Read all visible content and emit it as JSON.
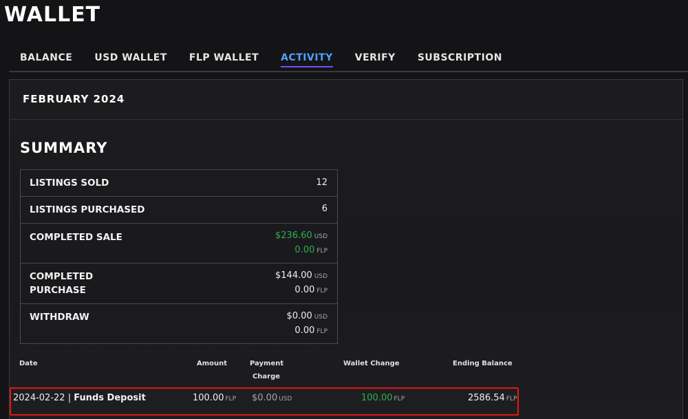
{
  "header": {
    "title": "WALLET"
  },
  "tabs": [
    {
      "label": "BALANCE",
      "active": false
    },
    {
      "label": "USD WALLET",
      "active": false
    },
    {
      "label": "FLP WALLET",
      "active": false
    },
    {
      "label": "ACTIVITY",
      "active": true
    },
    {
      "label": "VERIFY",
      "active": false
    },
    {
      "label": "SUBSCRIPTION",
      "active": false
    }
  ],
  "month": {
    "title": "FEBRUARY 2024"
  },
  "summary": {
    "title": "SUMMARY",
    "rows": [
      {
        "label": "LISTINGS SOLD",
        "value": "12"
      },
      {
        "label": "LISTINGS PURCHASED",
        "value": "6"
      },
      {
        "label": "COMPLETED SALE",
        "usd": "$236.60",
        "usd_unit": "USD",
        "flp": "0.00",
        "flp_unit": "FLP"
      },
      {
        "label_line1": "COMPLETED",
        "label_line2": "PURCHASE",
        "usd": "$144.00",
        "usd_unit": "USD",
        "flp": "0.00",
        "flp_unit": "FLP"
      },
      {
        "label": "WITHDRAW",
        "usd": "$0.00",
        "usd_unit": "USD",
        "flp": "0.00",
        "flp_unit": "FLP"
      }
    ]
  },
  "transactions": {
    "headers": {
      "date": "Date",
      "amount": "Amount",
      "payment_line1": "Payment",
      "payment_line2": "Charge",
      "wallet_change": "Wallet Change",
      "ending_balance": "Ending Balance"
    },
    "rows": [
      {
        "date": "2024-02-22",
        "separator": "|",
        "type": "Funds Deposit",
        "amount": "100.00",
        "amount_unit": "FLP",
        "payment_charge": "$0.00",
        "payment_unit": "USD",
        "wallet_change": "100.00",
        "wallet_unit": "FLP",
        "ending_balance": "2586.54",
        "ending_unit": "FLP"
      }
    ]
  },
  "colors": {
    "accent_tab": "#4aa3ff",
    "positive": "#2fb04a",
    "highlight_border": "#e01818"
  }
}
